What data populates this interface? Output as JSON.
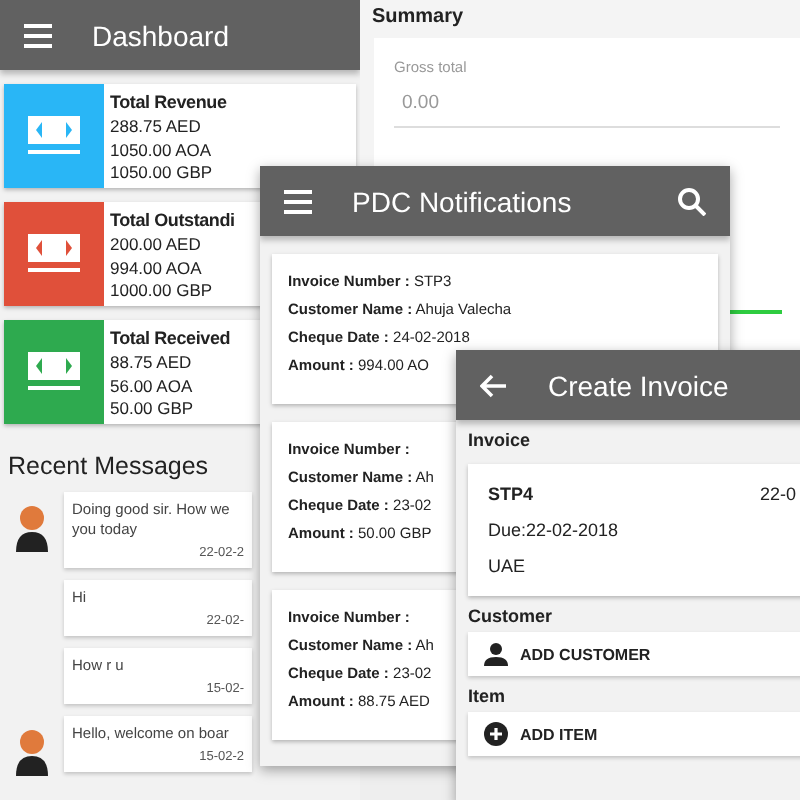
{
  "dashboard": {
    "title": "Dashboard",
    "cards": [
      {
        "title": "Total Revenue",
        "color": "#29b6f6",
        "lines": [
          "288.75 AED",
          "1050.00 AOA",
          "1050.00 GBP"
        ]
      },
      {
        "title": "Total Outstandi",
        "color": "#e0503a",
        "lines": [
          "200.00 AED",
          "994.00 AOA",
          "1000.00 GBP"
        ]
      },
      {
        "title": "Total Received",
        "color": "#2eaa4f",
        "lines": [
          "88.75 AED",
          "56.00 AOA",
          "50.00 GBP"
        ]
      }
    ],
    "messages_title": "Recent Messages",
    "messages": [
      {
        "avatar": true,
        "lines": [
          "Doing good sir. How we",
          "you today"
        ],
        "date": "22-02-2"
      },
      {
        "avatar": false,
        "lines": [
          "Hi"
        ],
        "date": "22-02-"
      },
      {
        "avatar": false,
        "lines": [
          "How r u"
        ],
        "date": "15-02-"
      },
      {
        "avatar": true,
        "lines": [
          "Hello, welcome on boar"
        ],
        "date": "15-02-2"
      }
    ]
  },
  "summary": {
    "title": "Summary",
    "field_label": "Gross total",
    "field_value": "0.00"
  },
  "pdc": {
    "title": "PDC Notifications",
    "cards": [
      {
        "lines": [
          "**Invoice Number :** STP3",
          "**Customer Name :** Ahuja Valecha",
          "**Cheque Date :** 24-02-2018",
          "**Amount :** 994.00 AO"
        ]
      },
      {
        "lines": [
          "**Invoice Number :**",
          "**Customer Name :** Ah",
          "**Cheque Date :** 23-02",
          "**Amount :** 50.00 GBP"
        ]
      },
      {
        "lines": [
          "**Invoice Number :**",
          "**Customer Name :** Ah",
          "**Cheque Date :** 23-02",
          "**Amount :** 88.75 AED"
        ]
      }
    ]
  },
  "create_invoice": {
    "title": "Create Invoice",
    "invoice_label": "Invoice",
    "number": "STP4",
    "date": "22-0",
    "due": "Due:22-02-2018",
    "region": "UAE",
    "customer_label": "Customer",
    "add_customer": "ADD CUSTOMER",
    "item_label": "Item",
    "add_item": "ADD ITEM"
  }
}
